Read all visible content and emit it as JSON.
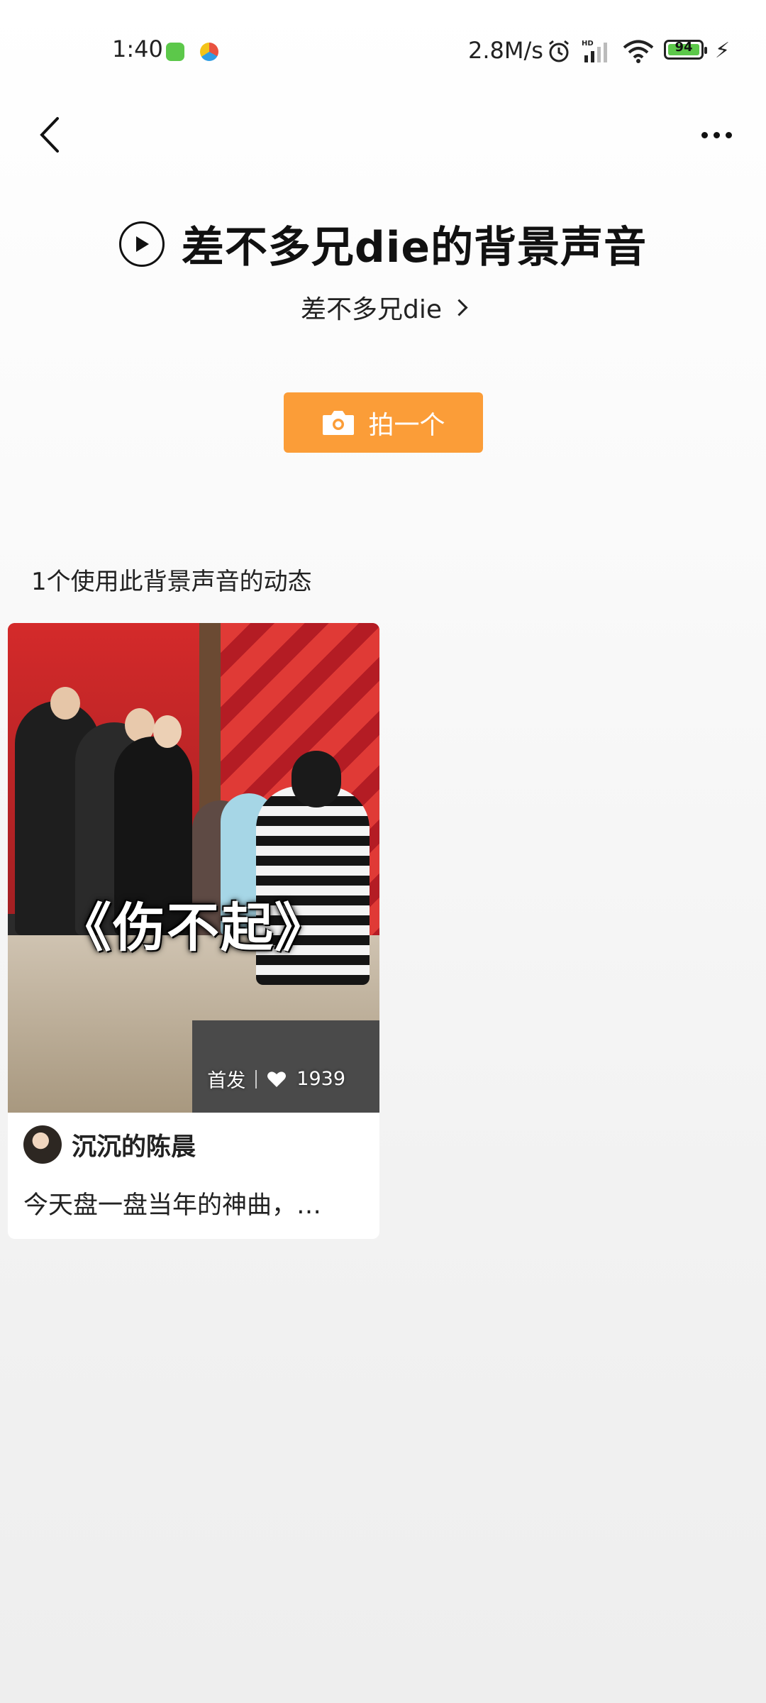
{
  "status_bar": {
    "time": "1:40",
    "net_speed": "2.8M/s",
    "battery": "94",
    "icons": [
      "app-notification-icon",
      "app-notification-icon-2",
      "alarm-icon",
      "signal-icon",
      "wifi-icon",
      "battery-icon",
      "charging-icon"
    ]
  },
  "nav": {
    "back_icon": "chevron-left-icon",
    "more_icon": "more-horizontal-icon"
  },
  "header": {
    "title": "差不多兄die的背景声音",
    "artist": "差不多兄die"
  },
  "actions": {
    "shoot_label": "拍一个"
  },
  "feed": {
    "count_label": "1个使用此背景声音的动态",
    "items": [
      {
        "overlay_title": "《伤不起》",
        "badge": "首发",
        "likes": "1939",
        "username": "沉沉的陈晨",
        "caption": "今天盘一盘当年的神曲，…"
      }
    ]
  },
  "colors": {
    "accent": "#fb9d38"
  }
}
